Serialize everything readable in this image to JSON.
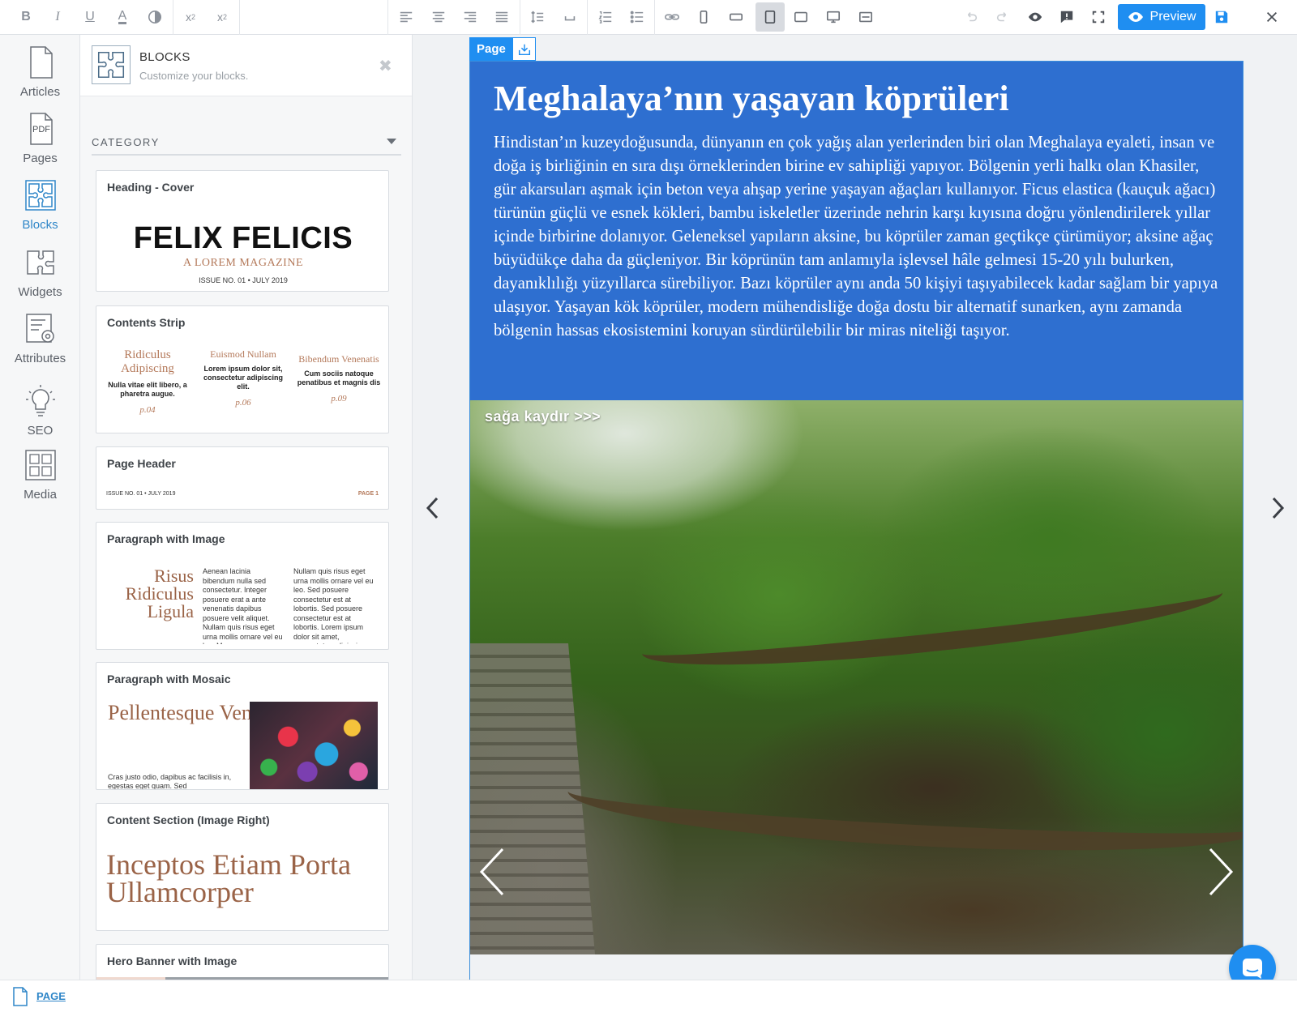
{
  "toolbar": {
    "preview_label": "Preview"
  },
  "rail": {
    "items": [
      {
        "label": "Articles",
        "icon": "document-icon"
      },
      {
        "label": "Pages",
        "icon": "pdf-icon"
      },
      {
        "label": "Blocks",
        "icon": "puzzle-icon",
        "active": true
      },
      {
        "label": "Widgets",
        "icon": "widget-puzzle-icon"
      },
      {
        "label": "Attributes",
        "icon": "attributes-gear-icon"
      },
      {
        "label": "SEO",
        "icon": "lightbulb-icon"
      },
      {
        "label": "Media",
        "icon": "media-grid-icon"
      }
    ],
    "pdf_badge": "PDF"
  },
  "panel": {
    "title": "BLOCKS",
    "subtitle": "Customize your blocks.",
    "category_label": "CATEGORY",
    "cards": [
      {
        "title": "Heading - Cover",
        "preview": {
          "brand": "FELIX FELICIS",
          "tagline": "A LOREM MAGAZINE",
          "issue": "ISSUE NO. 01 • JULY 2019"
        }
      },
      {
        "title": "Contents Strip",
        "preview": {
          "cols": [
            {
              "heading": "Ridiculus Adipiscing",
              "body": "Nulla vitae elit libero, a pharetra augue.",
              "page": "p.04"
            },
            {
              "heading": "Euismod Nullam",
              "body": "Lorem ipsum dolor sit, consectetur adipiscing elit.",
              "page": "p.06"
            },
            {
              "heading": "Bibendum Venenatis",
              "body": "Cum sociis natoque penatibus et magnis dis",
              "page": "p.09"
            }
          ]
        }
      },
      {
        "title": "Page Header",
        "preview": {
          "left": "ISSUE NO. 01 • JULY 2019",
          "right": "PAGE 1"
        }
      },
      {
        "title": "Paragraph with Image",
        "preview": {
          "big": "Risus Ridiculus Ligula",
          "col1": "Aenean lacinia bibendum nulla sed consectetur. Integer posuere erat a ante venenatis dapibus posuere velit aliquet. Nullam quis risus eget urna mollis ornare vel eu leo. Maecenas",
          "col2": "Nullam quis risus eget urna mollis ornare vel eu leo. Sed posuere consectetur est at lobortis. Sed posuere consectetur est at lobortis. Lorem ipsum dolor sit amet, consectetur adipiscing"
        }
      },
      {
        "title": "Paragraph with Mosaic",
        "preview": {
          "big": "Pellentesque Venenatis Aenean",
          "small": "Cras justo odio, dapibus ac facilisis in, egestas eget quam. Sed"
        }
      },
      {
        "title": "Content Section (Image Right)",
        "preview": {
          "big": "Inceptos Etiam Porta Ullamcorper"
        }
      },
      {
        "title": "Hero Banner with Image"
      }
    ]
  },
  "canvas": {
    "page_tag": "Page",
    "article": {
      "title": "Meghalaya’nın yaşayan köprüleri",
      "body": "Hindistan’ın kuzeydoğusunda, dünyanın en çok yağış alan yerlerinden biri olan Meghalaya eyaleti, insan ve doğa iş birliğinin en sıra dışı örneklerinden birine ev sahipliği yapıyor. Bölgenin yerli halkı olan Khasiler, gür akarsuları aşmak için beton veya ahşap yerine yaşayan ağaçları kullanıyor. Ficus elastica (kauçuk ağacı) türünün güçlü ve esnek kökleri, bambu iskeletler üzerinde nehrin karşı kıyısına doğru yönlendirilerek yıllar içinde birbirine dolanıyor. Geleneksel yapıların aksine, bu köprüler zaman geçtikçe çürümüyor; aksine ağaç büyüdükçe daha da güçleniyor. Bir köprünün tam anlamıyla işlevsel hâle gelmesi 15-20 yılı bulurken, dayanıklılığı yüzyıllarca sürebiliyor. Bazı köprüler aynı anda 50 kişiyi taşıyabilecek kadar sağlam bir yapıya ulaşıyor. Yaşayan kök köprüler, modern mühendisliğe doğa dostu bir alternatif sunarken, aynı zamanda bölgenin hassas ekosistemini koruyan sürdürülebilir bir miras niteliği taşıyor."
    },
    "slider": {
      "swipe_hint": "sağa kaydır >>>"
    }
  },
  "bottombar": {
    "label": "PAGE"
  },
  "colors": {
    "accent": "#1f8ef1",
    "article_bg": "#2e6fd0",
    "card_accent": "#b4795a"
  }
}
